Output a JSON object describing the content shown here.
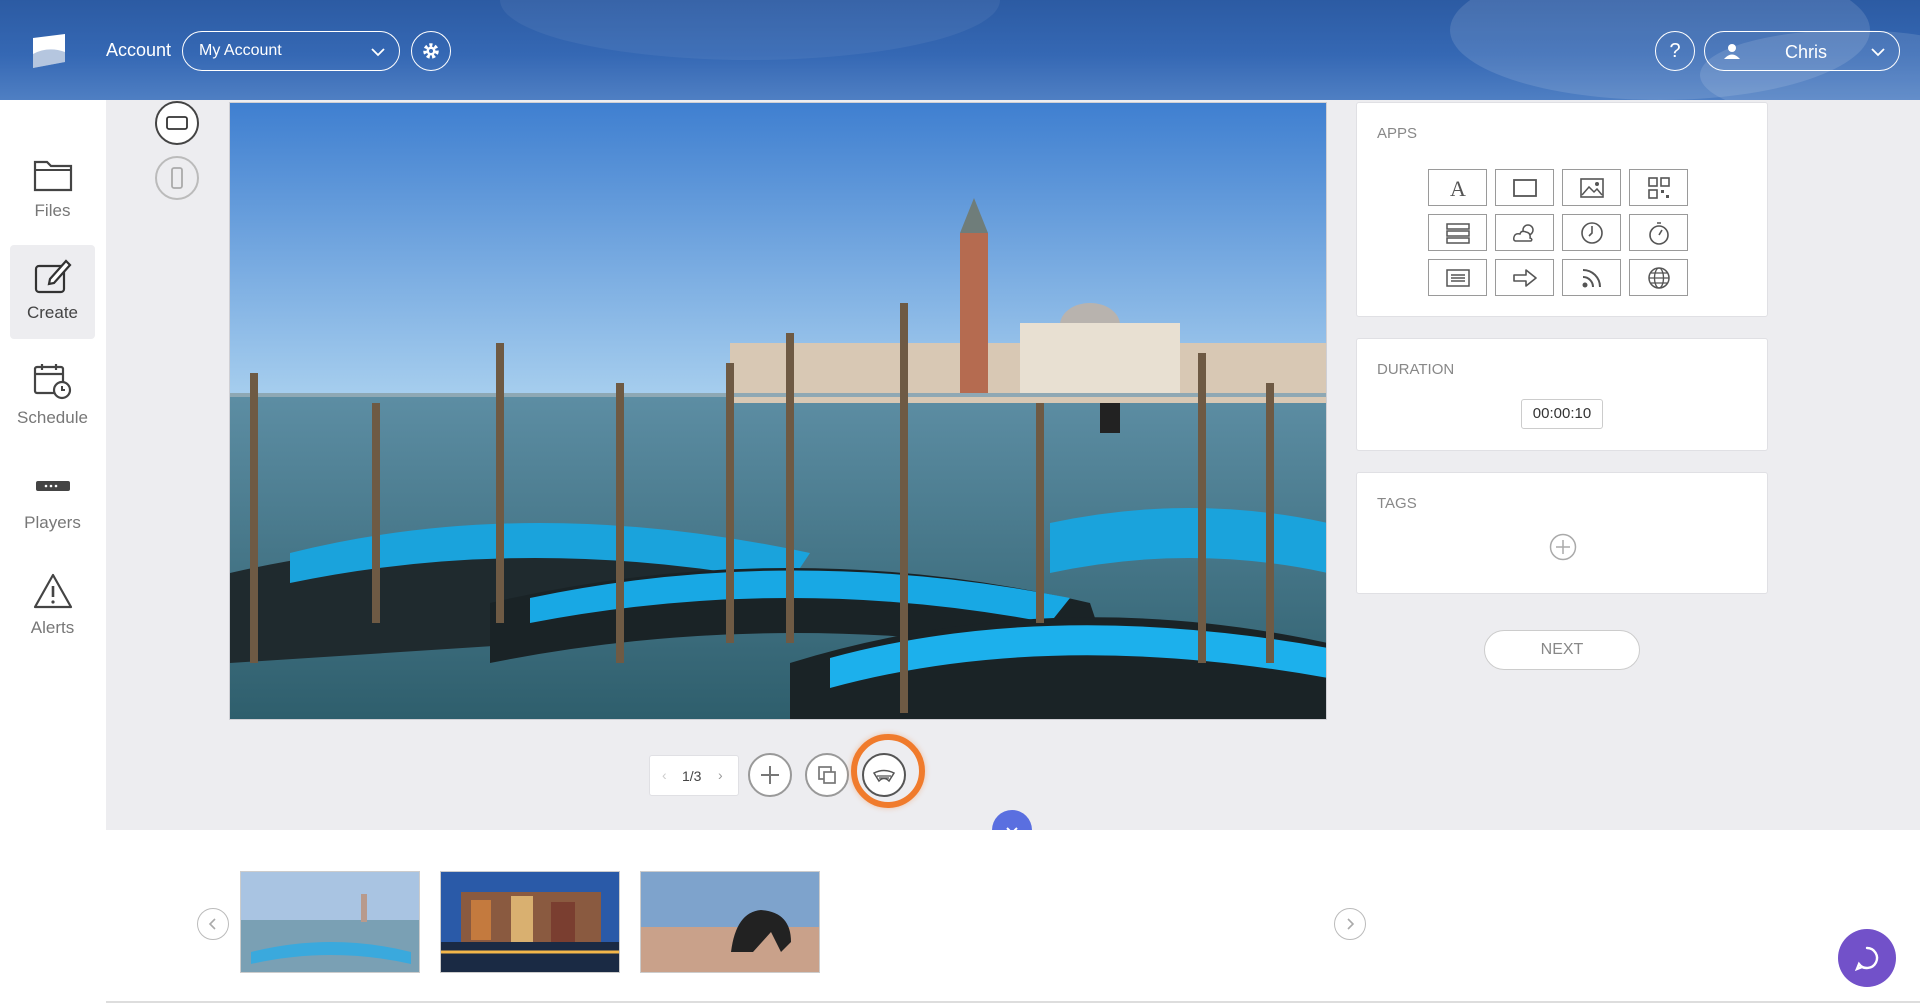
{
  "header": {
    "account_label": "Account",
    "account_select_value": "My Account",
    "help_label": "?",
    "user_name": "Chris"
  },
  "sidebar": {
    "items": [
      {
        "label": "Files",
        "icon": "folder-icon",
        "active": false
      },
      {
        "label": "Create",
        "icon": "edit-icon",
        "active": true
      },
      {
        "label": "Schedule",
        "icon": "calendar-clock-icon",
        "active": false
      },
      {
        "label": "Players",
        "icon": "player-device-icon",
        "active": false
      },
      {
        "label": "Alerts",
        "icon": "warning-icon",
        "active": false
      }
    ]
  },
  "orientation": {
    "options": [
      "landscape-icon",
      "portrait-icon"
    ],
    "selected": "landscape"
  },
  "canvas": {
    "image": "Venice gondolas slide"
  },
  "panels": {
    "apps": {
      "title": "APPS",
      "icons": [
        "text-icon",
        "rectangle-icon",
        "image-icon",
        "qr-code-icon",
        "table-icon",
        "weather-icon",
        "clock-icon",
        "timer-icon",
        "list-icon",
        "arrow-icon",
        "rss-icon",
        "web-icon"
      ]
    },
    "duration": {
      "title": "DURATION",
      "value": "00:00:10"
    },
    "tags": {
      "title": "TAGS"
    }
  },
  "next_label": "NEXT",
  "slide_controls": {
    "pager": "1/3",
    "prev": "‹",
    "next": "›"
  },
  "accent_colors": {
    "highlight": "#f07b2c",
    "collapse": "#5a6fe0",
    "chat": "#7251c9",
    "header": "#2c5ba3"
  }
}
